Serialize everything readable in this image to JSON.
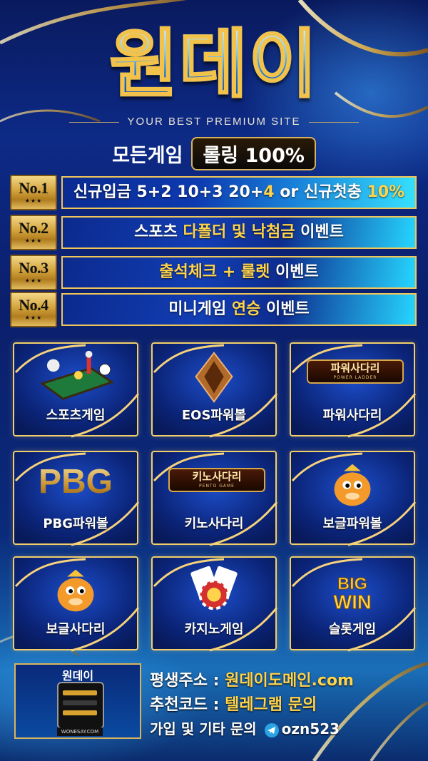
{
  "header": {
    "logo_text": "원데이",
    "tagline": "YOUR BEST PREMIUM SITE",
    "promo_left": "모든게임",
    "promo_right": "롤링 100%"
  },
  "ranks": [
    {
      "num": "No.1",
      "stars": "★★★",
      "parts": [
        {
          "t": "신규입금 5+2 10+3 20+",
          "gold": false
        },
        {
          "t": "4",
          "gold": true
        },
        {
          "t": " or 신규첫충 ",
          "gold": false
        },
        {
          "t": "10%",
          "gold": true
        }
      ]
    },
    {
      "num": "No.2",
      "stars": "★★★",
      "parts": [
        {
          "t": "스포츠 ",
          "gold": false
        },
        {
          "t": "다폴더 및 낙첨금",
          "gold": true
        },
        {
          "t": " 이벤트",
          "gold": false
        }
      ]
    },
    {
      "num": "No.3",
      "stars": "★★★",
      "parts": [
        {
          "t": "출석체크 + 룰렛",
          "gold": true
        },
        {
          "t": " 이벤트",
          "gold": false
        }
      ]
    },
    {
      "num": "No.4",
      "stars": "★★★",
      "parts": [
        {
          "t": "미니게임 ",
          "gold": false
        },
        {
          "t": "연승",
          "gold": true
        },
        {
          "t": " 이벤트",
          "gold": false
        }
      ]
    }
  ],
  "games": [
    {
      "label": "스포츠게임",
      "icon": "sports-table-icon"
    },
    {
      "label": "EOS파워볼",
      "icon": "eos-crystal-icon"
    },
    {
      "label": "파워사다리",
      "icon": "power-ladder-sign-icon",
      "sign_title": "파워사다리",
      "sign_sub": "POWER LADDER"
    },
    {
      "label": "PBG파워볼",
      "icon": "pbg-logo-icon",
      "art_text": "PBG"
    },
    {
      "label": "키노사다리",
      "icon": "keno-ladder-sign-icon",
      "sign_title": "키노사다리",
      "sign_sub": "PENTO GAME"
    },
    {
      "label": "보글파워볼",
      "icon": "bubble-dragon-icon"
    },
    {
      "label": "보글사다리",
      "icon": "bubble-dragon-icon"
    },
    {
      "label": "카지노게임",
      "icon": "casino-chips-icon"
    },
    {
      "label": "슬롯게임",
      "icon": "big-win-icon",
      "art_text_1": "BIG",
      "art_text_2": "WIN"
    }
  ],
  "footer": {
    "thumb_name": "원데이",
    "thumb_url": "WONESAY.COM",
    "line1_label": "평생주소 : ",
    "line1_value": "원데이도메인.com",
    "line2_label": "추천코드 : ",
    "line2_value": "텔레그램 문의",
    "line3_label": "가입 및 기타 문의 ",
    "line3_value": "ozn523"
  },
  "colors": {
    "gold": "#ffd34a",
    "accent_blue": "#1a78d8",
    "frame_gold": "#f2cf6a"
  }
}
